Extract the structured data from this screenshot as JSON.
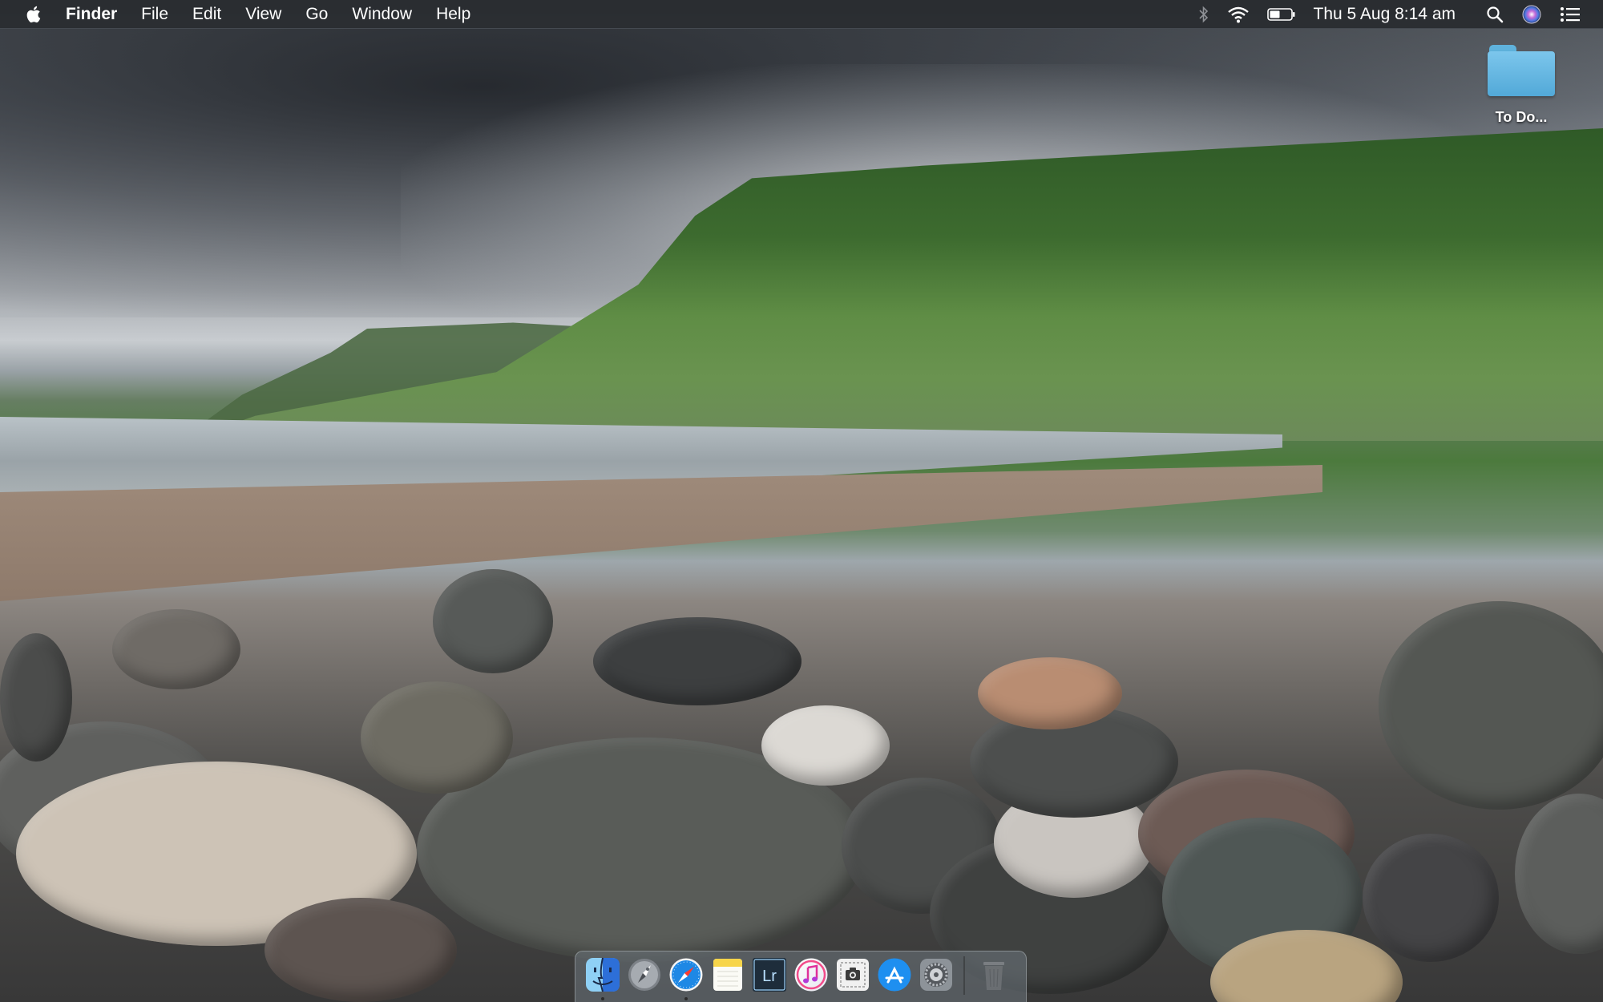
{
  "menubar": {
    "apple_icon": "apple-icon",
    "app_name": "Finder",
    "items": [
      "File",
      "Edit",
      "View",
      "Go",
      "Window",
      "Help"
    ],
    "status": {
      "bluetooth_icon": "bluetooth-icon",
      "wifi_icon": "wifi-icon",
      "battery_icon": "battery-icon",
      "clock": "Thu 5 Aug  8:14 am",
      "spotlight_icon": "search-icon",
      "siri_icon": "siri-icon",
      "notification_icon": "notification-center-icon"
    }
  },
  "desktop": {
    "icons": [
      {
        "label": "To Do...",
        "type": "folder-icon"
      }
    ]
  },
  "dock": {
    "apps": [
      {
        "name": "finder-icon",
        "running": true
      },
      {
        "name": "launchpad-icon",
        "running": false
      },
      {
        "name": "safari-icon",
        "running": true
      },
      {
        "name": "notes-icon",
        "running": false
      },
      {
        "name": "lightroom-icon",
        "label": "Lr",
        "running": false
      },
      {
        "name": "music-icon",
        "running": false
      },
      {
        "name": "screenshot-icon",
        "running": false
      },
      {
        "name": "app-store-icon",
        "running": false
      },
      {
        "name": "system-preferences-icon",
        "running": false
      }
    ],
    "trash": "trash-icon"
  },
  "colors": {
    "menubar_bg": "#26282c",
    "folder_blue": "#52a9d8",
    "safari_blue": "#1e88e5"
  }
}
